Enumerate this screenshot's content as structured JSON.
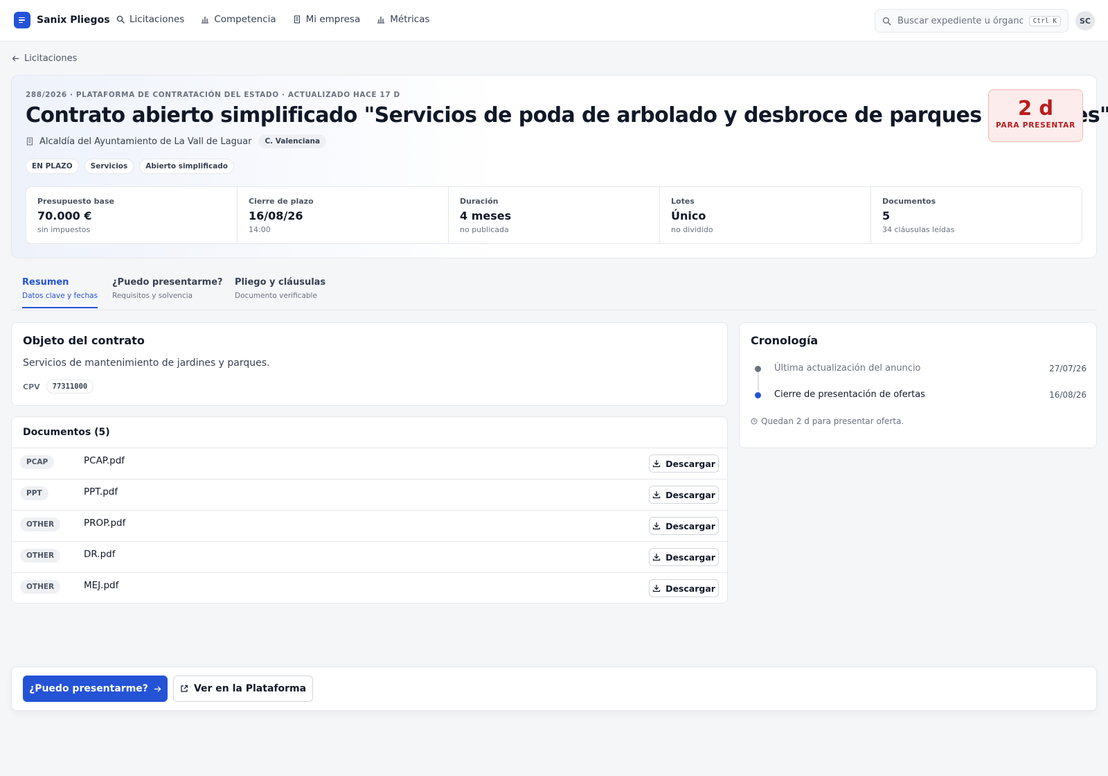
{
  "app": {
    "name": "Sanix Pliegos",
    "nav": [
      {
        "label": "Licitaciones",
        "icon": "search-icon"
      },
      {
        "label": "Competencia",
        "icon": "bar-chart-icon"
      },
      {
        "label": "Mi empresa",
        "icon": "building-icon"
      },
      {
        "label": "Métricas",
        "icon": "bar-chart-icon"
      }
    ],
    "search": {
      "placeholder": "Buscar expediente u órgano...",
      "shortcut": "Ctrl K"
    },
    "user_initials": "SC"
  },
  "back": {
    "label": "Licitaciones"
  },
  "header": {
    "meta": "288/2026 · PLATAFORMA DE CONTRATACIÓN DEL ESTADO · ACTUALIZADO HACE 17 D",
    "title": "Contrato abierto simplificado \"Servicios de poda de arbolado y desbroce de parques y jardines\"",
    "organ": "Alcaldía del Ayuntamiento de La Vall de Laguar",
    "region": "C. Valenciana",
    "tags": [
      "EN PLAZO",
      "Servicios",
      "Abierto simplificado"
    ],
    "deadline": {
      "value": "2 d",
      "label": "PARA PRESENTAR",
      "color": "#b91c1c"
    },
    "stats": [
      {
        "label": "Presupuesto base",
        "value": "70.000 €",
        "sub": "sin impuestos"
      },
      {
        "label": "Cierre de plazo",
        "value": "16/08/26",
        "sub": "14:00"
      },
      {
        "label": "Duración",
        "value": "4 meses",
        "sub": "no publicada"
      },
      {
        "label": "Lotes",
        "value": "Único",
        "sub": "no dividido"
      },
      {
        "label": "Documentos",
        "value": "5",
        "sub": "34 cláusulas leídas"
      }
    ]
  },
  "tabs": [
    {
      "label": "Resumen",
      "sub": "Datos clave y fechas",
      "active": true
    },
    {
      "label": "¿Puedo presentarme?",
      "sub": "Requisitos y solvencia",
      "active": false
    },
    {
      "label": "Pliego y cláusulas",
      "sub": "Documento verificable",
      "active": false
    }
  ],
  "object": {
    "title": "Objeto del contrato",
    "description": "Servicios de mantenimiento de jardines y parques.",
    "cpv_label": "CPV",
    "cpv_code": "77311000"
  },
  "documents": {
    "title": "Documentos (5)",
    "download_label": "Descargar",
    "items": [
      {
        "type": "PCAP",
        "name": "PCAP.pdf"
      },
      {
        "type": "PPT",
        "name": "PPT.pdf"
      },
      {
        "type": "OTHER",
        "name": "PROP.pdf"
      },
      {
        "type": "OTHER",
        "name": "DR.pdf"
      },
      {
        "type": "OTHER",
        "name": "MEJ.pdf"
      }
    ]
  },
  "timeline": {
    "title": "Cronología",
    "items": [
      {
        "label": "Última actualización del anuncio",
        "date": "27/07/26",
        "status": "past"
      },
      {
        "label": "Cierre de presentación de ofertas",
        "date": "16/08/26",
        "status": "upcoming"
      }
    ],
    "note": "Quedan 2 d para presentar oferta."
  },
  "actions": {
    "primary": "¿Puedo presentarme?",
    "secondary": "Ver en la Plataforma"
  },
  "colors": {
    "accent": "#2453d6",
    "danger": "#b91c1c",
    "past_dot": "#6b7280"
  }
}
